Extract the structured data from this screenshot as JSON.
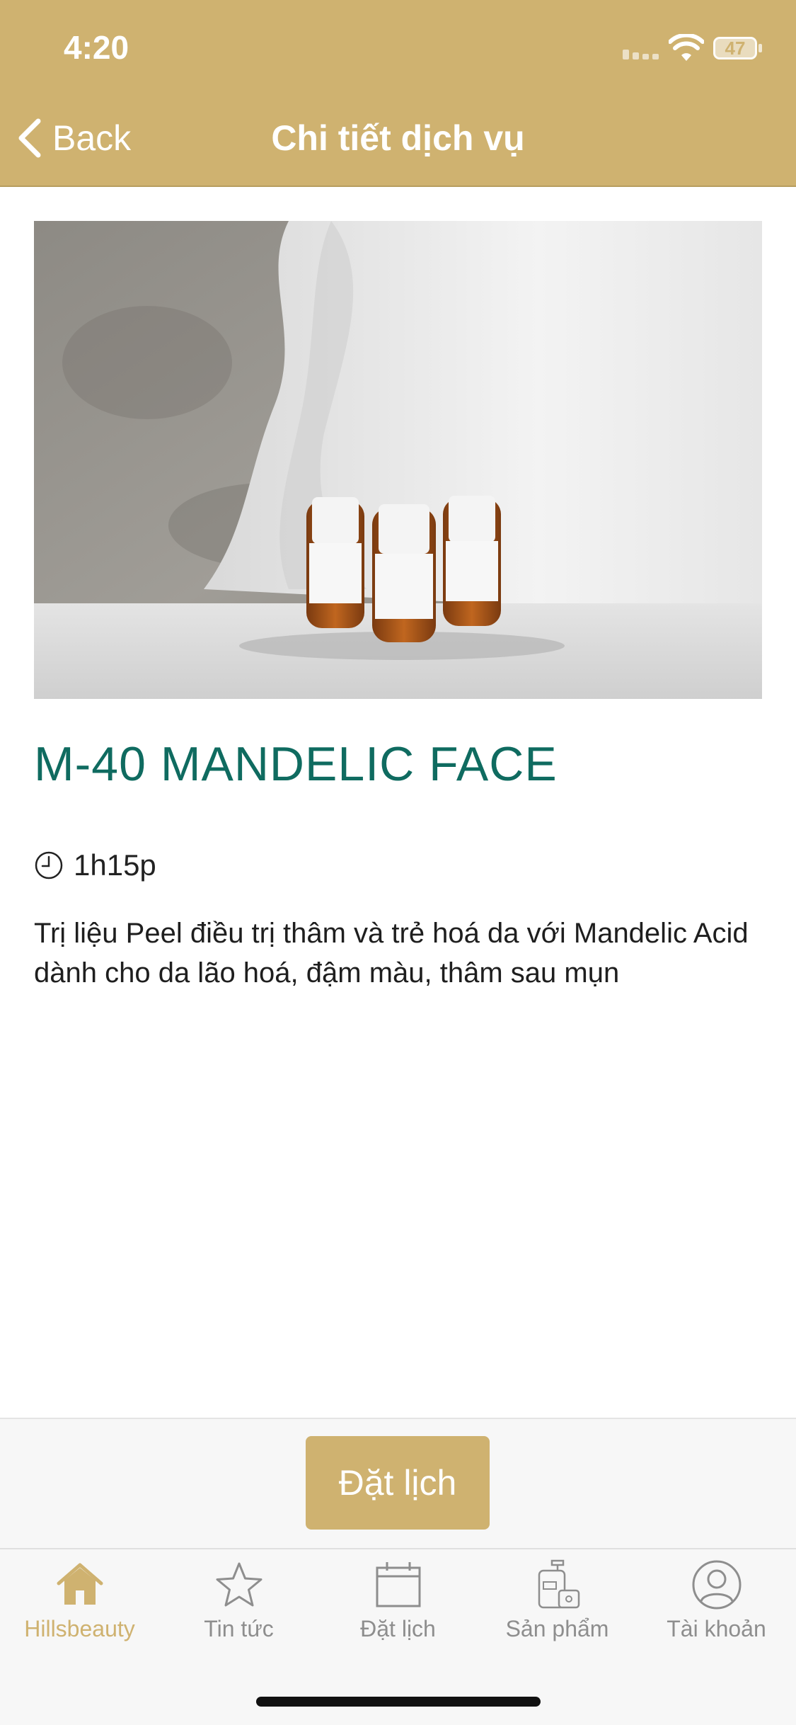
{
  "status": {
    "time": "4:20",
    "battery": "47"
  },
  "nav": {
    "back_label": "Back",
    "title": "Chi tiết dịch vụ"
  },
  "hero_icon": "product-photo",
  "service": {
    "name": "M-40 MANDELIC FACE",
    "duration": "1h15p",
    "description": "Trị liệu Peel điều trị thâm và trẻ hoá da với Mandelic Acid dành cho da lão hoá, đậm màu, thâm sau mụn"
  },
  "cta": {
    "book_label": "Đặt lịch"
  },
  "tabs": [
    {
      "label": "Hillsbeauty",
      "icon": "home-icon",
      "active": true
    },
    {
      "label": "Tin tức",
      "icon": "star-icon",
      "active": false
    },
    {
      "label": "Đặt lịch",
      "icon": "calendar-icon",
      "active": false
    },
    {
      "label": "Sản phẩm",
      "icon": "products-icon",
      "active": false
    },
    {
      "label": "Tài khoản",
      "icon": "account-icon",
      "active": false
    }
  ],
  "colors": {
    "accent": "#cfb270",
    "title": "#0f6b60",
    "inactive": "#8e8e8e"
  }
}
